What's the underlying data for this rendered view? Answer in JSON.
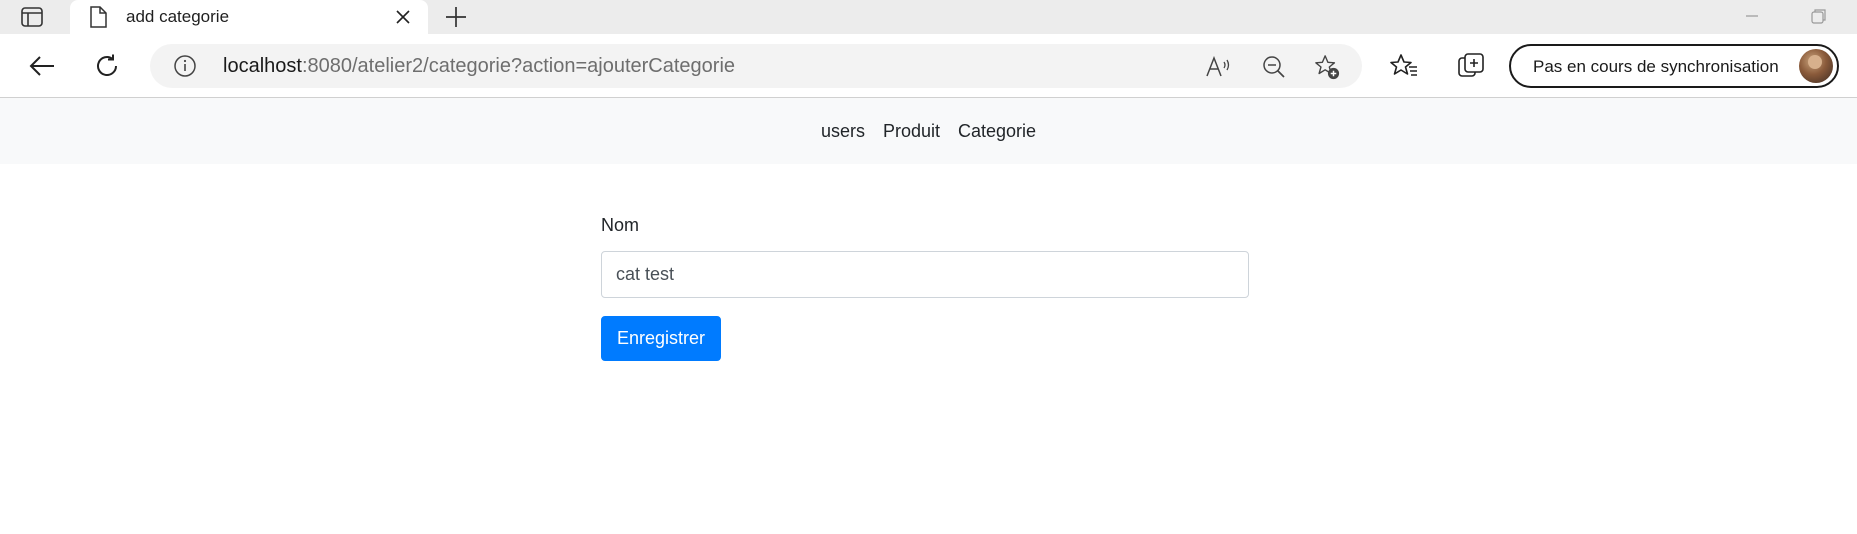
{
  "browser": {
    "tab": {
      "title": "add categorie",
      "icon": "page-icon"
    },
    "address": {
      "host": "localhost",
      "rest": ":8080/atelier2/categorie?action=ajouterCategorie"
    },
    "profile": {
      "label": "Pas en cours de synchronisation"
    },
    "icons": [
      "tab-actions-icon",
      "close-icon",
      "new-tab-icon",
      "minimize-icon",
      "restore-icon",
      "back-arrow-icon",
      "refresh-icon",
      "info-icon",
      "read-aloud-icon",
      "zoom-out-icon",
      "add-favorite-icon",
      "favorites-icon",
      "collections-icon",
      "avatar"
    ]
  },
  "navbar": {
    "links": [
      "users",
      "Produit",
      "Categorie"
    ]
  },
  "form": {
    "nom_label": "Nom",
    "nom_value": "cat test",
    "submit_label": "Enregistrer"
  },
  "colors": {
    "primary": "#007bff",
    "navbar_bg": "#f8f9fa",
    "tabstrip_bg": "#ececec"
  }
}
